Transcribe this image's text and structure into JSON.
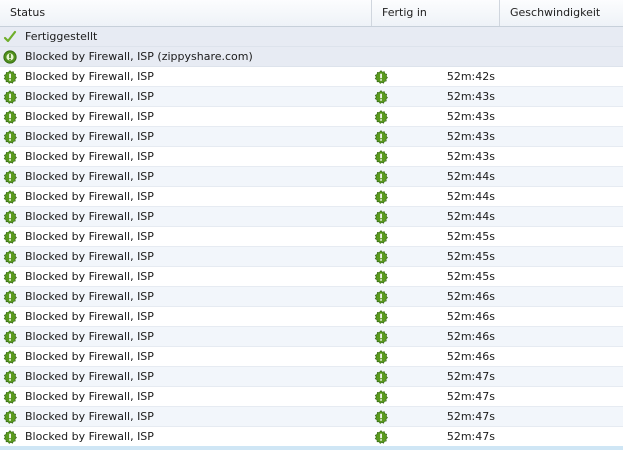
{
  "columns": {
    "status": "Status",
    "fertig": "Fertig in",
    "speed": "Geschwindigkeit"
  },
  "groups": [
    {
      "label": "Fertiggestellt",
      "icon": "checkmark-icon"
    },
    {
      "label": "Blocked by Firewall, ISP (zippyshare.com)",
      "icon": "blocked-host-icon"
    }
  ],
  "rows": [
    {
      "status": "Blocked by Firewall, ISP",
      "eta": "52m:42s"
    },
    {
      "status": "Blocked by Firewall, ISP",
      "eta": "52m:43s"
    },
    {
      "status": "Blocked by Firewall, ISP",
      "eta": "52m:43s"
    },
    {
      "status": "Blocked by Firewall, ISP",
      "eta": "52m:43s"
    },
    {
      "status": "Blocked by Firewall, ISP",
      "eta": "52m:43s"
    },
    {
      "status": "Blocked by Firewall, ISP",
      "eta": "52m:44s"
    },
    {
      "status": "Blocked by Firewall, ISP",
      "eta": "52m:44s"
    },
    {
      "status": "Blocked by Firewall, ISP",
      "eta": "52m:44s"
    },
    {
      "status": "Blocked by Firewall, ISP",
      "eta": "52m:45s"
    },
    {
      "status": "Blocked by Firewall, ISP",
      "eta": "52m:45s"
    },
    {
      "status": "Blocked by Firewall, ISP",
      "eta": "52m:45s"
    },
    {
      "status": "Blocked by Firewall, ISP",
      "eta": "52m:46s"
    },
    {
      "status": "Blocked by Firewall, ISP",
      "eta": "52m:46s"
    },
    {
      "status": "Blocked by Firewall, ISP",
      "eta": "52m:46s"
    },
    {
      "status": "Blocked by Firewall, ISP",
      "eta": "52m:46s"
    },
    {
      "status": "Blocked by Firewall, ISP",
      "eta": "52m:47s"
    },
    {
      "status": "Blocked by Firewall, ISP",
      "eta": "52m:47s"
    },
    {
      "status": "Blocked by Firewall, ISP",
      "eta": "52m:47s"
    },
    {
      "status": "Blocked by Firewall, ISP",
      "eta": "52m:47s"
    }
  ],
  "colors": {
    "blocked_icon": "#5a9a1e",
    "checkmark": "#6fae2a"
  }
}
